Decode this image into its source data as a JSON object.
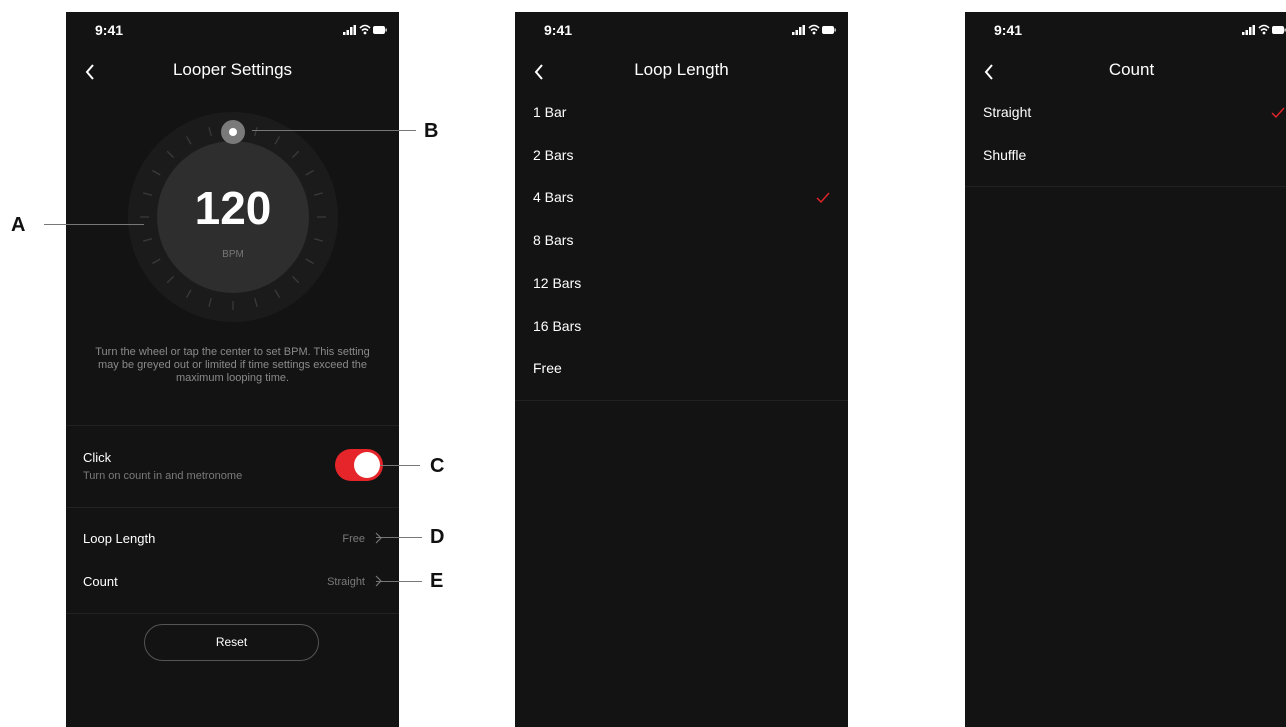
{
  "status": {
    "time": "9:41"
  },
  "screen1": {
    "title": "Looper Settings",
    "bpm_value": "120",
    "bpm_unit": "BPM",
    "hint": "Turn the wheel or tap the center to set BPM. This setting may be greyed out or limited if time settings exceed the maximum looping time.",
    "click": {
      "label": "Click",
      "sublabel": "Turn on count in and metronome",
      "enabled": true
    },
    "loop_length": {
      "label": "Loop Length",
      "value": "Free"
    },
    "count": {
      "label": "Count",
      "value": "Straight"
    },
    "reset_label": "Reset"
  },
  "screen2": {
    "title": "Loop Length",
    "options": [
      "1 Bar",
      "2 Bars",
      "4 Bars",
      "8 Bars",
      "12 Bars",
      "16 Bars",
      "Free"
    ],
    "selected": "4 Bars"
  },
  "screen3": {
    "title": "Count",
    "options": [
      "Straight",
      "Shuffle"
    ],
    "selected": "Straight"
  },
  "callouts": [
    "A",
    "B",
    "C",
    "D",
    "E"
  ],
  "colors": {
    "accent": "#e5252a",
    "background": "#131313"
  }
}
